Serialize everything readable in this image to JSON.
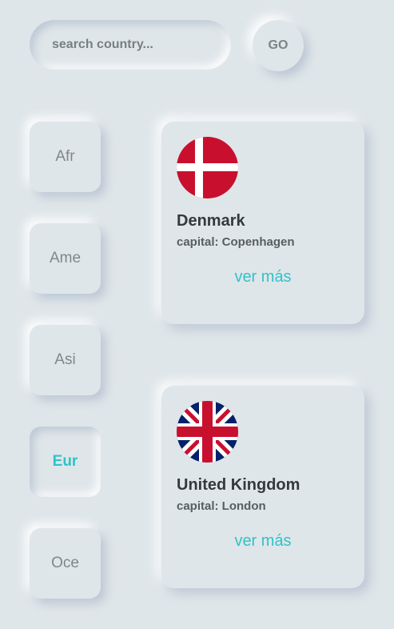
{
  "search": {
    "placeholder": "search country...",
    "value": ""
  },
  "go_label": "GO",
  "continents": [
    {
      "label": "Afr",
      "active": false
    },
    {
      "label": "Ame",
      "active": false
    },
    {
      "label": "Asi",
      "active": false
    },
    {
      "label": "Eur",
      "active": true
    },
    {
      "label": "Oce",
      "active": false
    }
  ],
  "countries": [
    {
      "name": "Denmark",
      "capital": "capital: Copenhagen",
      "more": "ver más",
      "flag": "denmark-flag-icon"
    },
    {
      "name": "United Kingdom",
      "capital": "capital: London",
      "more": "ver más",
      "flag": "united-kingdom-flag-icon"
    }
  ],
  "colors": {
    "background": "#dfe6e9",
    "accent": "#2fc3c9",
    "denmark_red": "#c8102e",
    "uk_blue": "#012169",
    "uk_red": "#c8102e"
  }
}
